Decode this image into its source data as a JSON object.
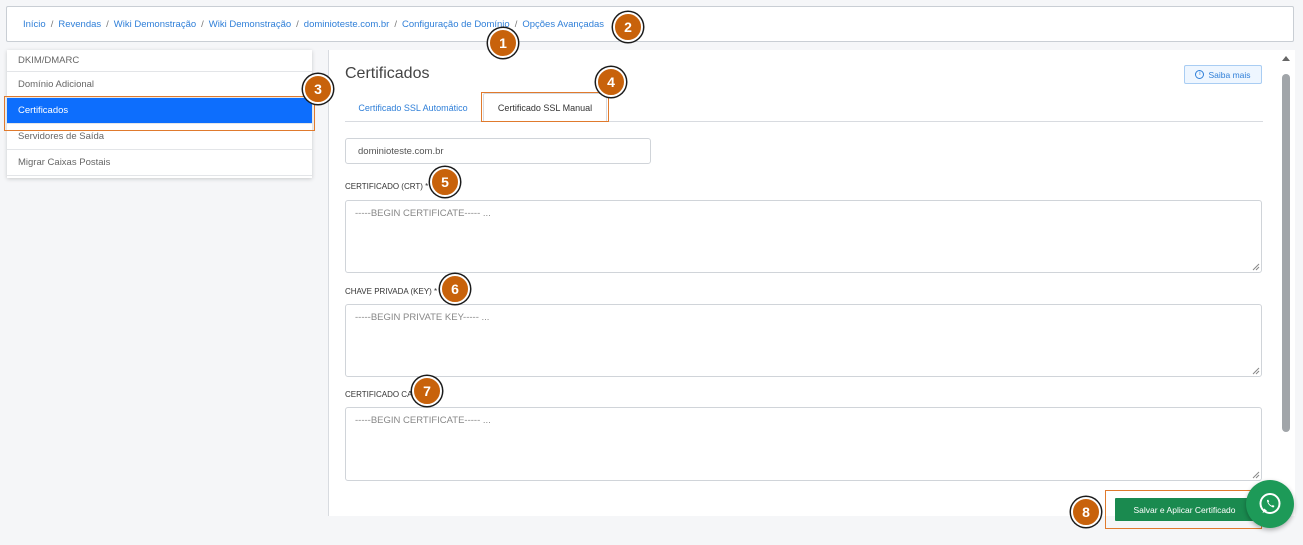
{
  "breadcrumb": [
    "Início",
    "Revendas",
    "Wiki Demonstração",
    "Wiki Demonstração",
    "dominioteste.com.br",
    "Configuração de Domínio",
    "Opções Avançadas"
  ],
  "breadcrumb_sep": "/",
  "sidebar": {
    "items": [
      {
        "label": "DKIM/DMARC"
      },
      {
        "label": "Domínio Adicional"
      },
      {
        "label": "Certificados"
      },
      {
        "label": "Servidores de Saída"
      },
      {
        "label": "Migrar Caixas Postais"
      }
    ]
  },
  "main": {
    "title": "Certificados",
    "help_button": "Saiba mais",
    "help_icon": "info-icon",
    "tabs": [
      "Certificado SSL Automático",
      "Certificado SSL Manual"
    ],
    "active_tab": "Certificado SSL Manual",
    "domain_value": "dominioteste.com.br",
    "fields": [
      {
        "label": "CERTIFICADO (CRT) *",
        "placeholder": "-----BEGIN CERTIFICATE----- ..."
      },
      {
        "label": "CHAVE PRIVADA (KEY) *",
        "placeholder": "-----BEGIN PRIVATE KEY----- ..."
      },
      {
        "label": "CERTIFICADO CA",
        "placeholder": "-----BEGIN CERTIFICATE----- ..."
      }
    ],
    "save_button": "Salvar e Aplicar Certificado"
  },
  "annotations": [
    "1",
    "2",
    "3",
    "4",
    "5",
    "6",
    "7",
    "8"
  ],
  "colors": {
    "link": "#2f7fd8",
    "active_item": "#0d6efd",
    "save_button": "#1a8a4f",
    "badge": "#c8620b",
    "highlight": "#e07a2d",
    "whatsapp": "#1d9a58"
  }
}
